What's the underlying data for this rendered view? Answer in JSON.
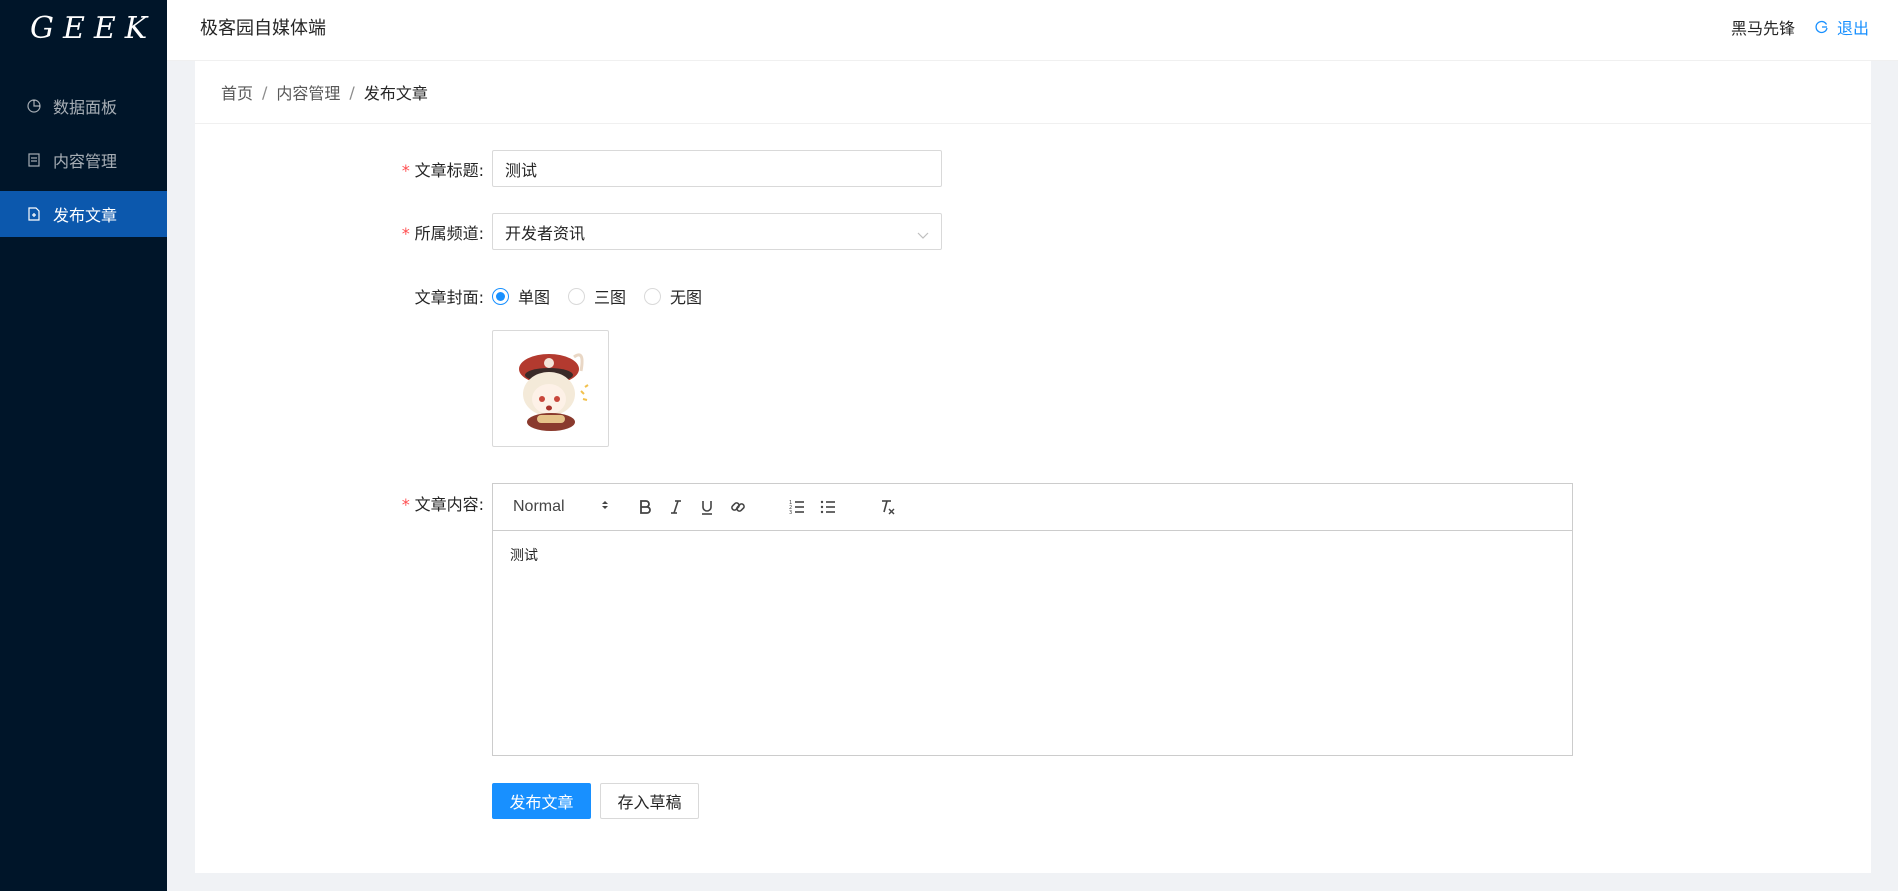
{
  "sidebar": {
    "logo": "GEEK",
    "items": [
      {
        "label": "数据面板",
        "icon": "pie-chart-icon"
      },
      {
        "label": "内容管理",
        "icon": "table-icon"
      },
      {
        "label": "发布文章",
        "icon": "file-add-icon",
        "active": true
      }
    ]
  },
  "header": {
    "title": "极客园自媒体端",
    "user": "黑马先锋",
    "logout": "退出"
  },
  "breadcrumb": [
    "首页",
    "内容管理",
    "发布文章"
  ],
  "breadcrumb_separator": "/",
  "form": {
    "title_label": "文章标题:",
    "title_value": "测试",
    "channel_label": "所属频道:",
    "channel_value": "开发者资讯",
    "cover_label": "文章封面:",
    "cover_options": [
      "单图",
      "三图",
      "无图"
    ],
    "cover_selected": "单图",
    "content_label": "文章内容:",
    "content_value": "测试",
    "required_mark": "*"
  },
  "editor_toolbar": {
    "format_select": "Normal",
    "buttons": [
      "bold-icon",
      "italic-icon",
      "underline-icon",
      "link-icon",
      "ordered-list-icon",
      "bullet-list-icon",
      "clear-format-icon"
    ]
  },
  "actions": {
    "publish": "发布文章",
    "draft": "存入草稿"
  },
  "colors": {
    "sidebar_bg": "#001529",
    "primary": "#1890ff",
    "required": "#ff4d4f"
  }
}
